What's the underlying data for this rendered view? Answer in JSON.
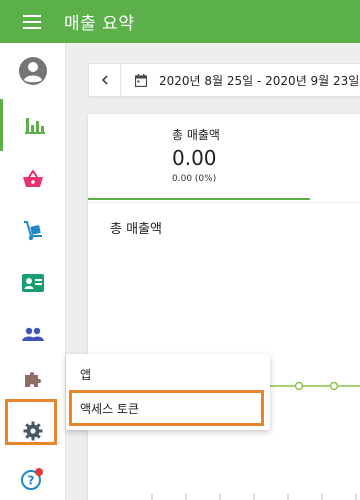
{
  "app": {
    "title": "매출 요약"
  },
  "date_range": {
    "label": "2020년 8월 25일 - 2020년 9월 23일"
  },
  "summary": {
    "label": "총 매출액",
    "value": "0.00",
    "change": "0.00 (0%)"
  },
  "chart": {
    "title": "총 매출액"
  },
  "flyout": {
    "items": [
      {
        "label": "앱"
      },
      {
        "label": "액세스 토큰"
      }
    ]
  },
  "colors": {
    "primary": "#5bb04a",
    "highlight": "#e8842c",
    "store_icon": "#e8336d",
    "delivery_icon": "#1e88c9",
    "customer_icon": "#169e72",
    "team_icon": "#3f51b5",
    "plugin_icon": "#8d6e63",
    "help_badge": "#e53935"
  },
  "chart_data": {
    "type": "line",
    "title": "총 매출액",
    "series": [
      {
        "values": [
          0,
          0,
          0
        ]
      }
    ]
  }
}
